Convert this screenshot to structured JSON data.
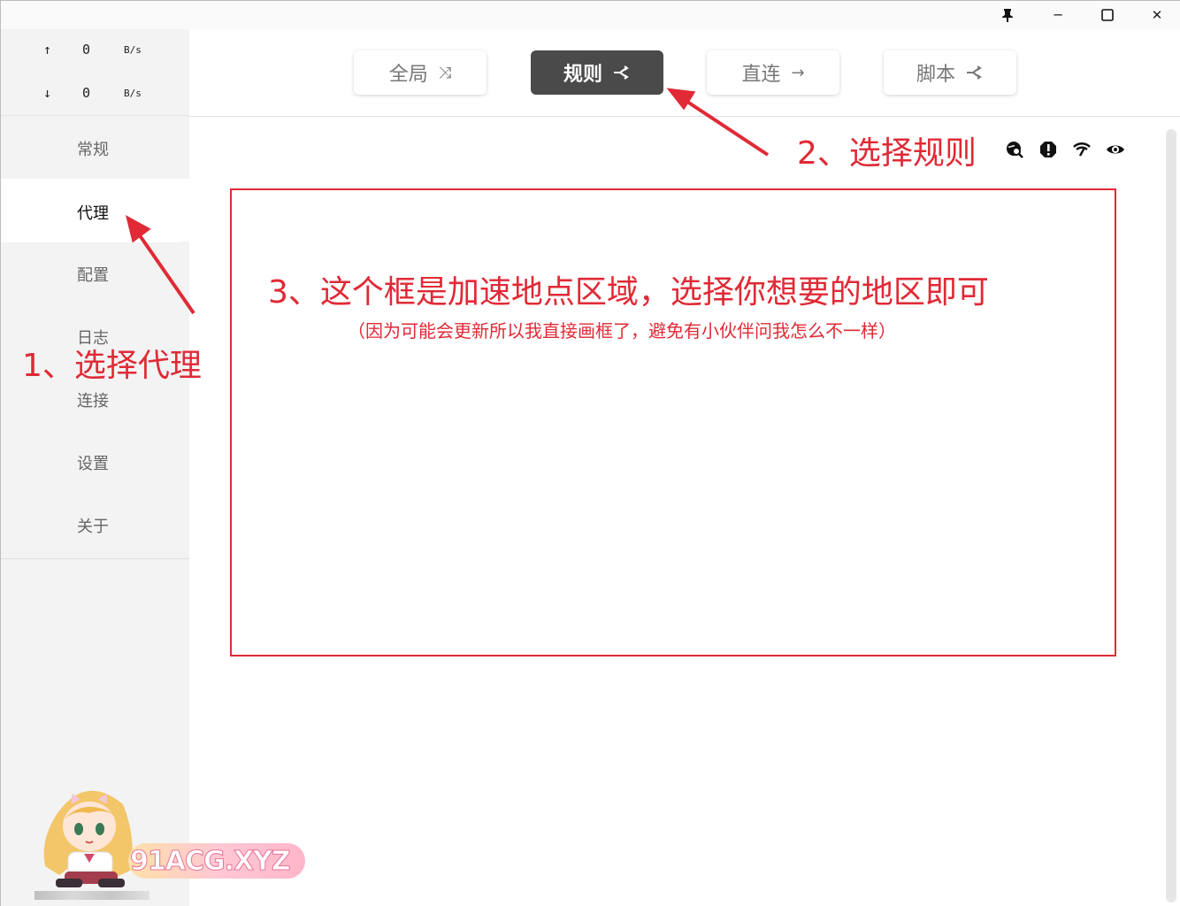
{
  "window": {
    "pin_icon": "pin-icon",
    "min_glyph": "─",
    "close_glyph": "✕"
  },
  "traffic": {
    "up_arrow": "↑",
    "up_value": "0",
    "up_unit": "B/s",
    "down_arrow": "↓",
    "down_value": "0",
    "down_unit": "B/s"
  },
  "sidebar": {
    "items": [
      {
        "label": "常规"
      },
      {
        "label": "代理"
      },
      {
        "label": "配置"
      },
      {
        "label": "日志"
      },
      {
        "label": "连接"
      },
      {
        "label": "设置"
      },
      {
        "label": "关于"
      }
    ],
    "active_index": 1
  },
  "modes": {
    "global": {
      "label": "全局",
      "icon": "⤨"
    },
    "rule": {
      "label": "规则",
      "icon": "⊰"
    },
    "direct": {
      "label": "直连",
      "icon": "→"
    },
    "script": {
      "label": "脚本",
      "icon": "⊰"
    },
    "active": "rule"
  },
  "toolbar": {
    "icons": [
      "globe-search-icon",
      "alert-icon",
      "wifi-speed-icon",
      "eye-icon"
    ]
  },
  "annotations": {
    "step1": "1、选择代理",
    "step2": "2、选择规则",
    "step3": "3、这个框是加速地点区域，选择你想要的地区即可",
    "step3_note": "（因为可能会更新所以我直接画框了，避免有小伙伴问我怎么不一样）"
  },
  "watermark": {
    "text": "91ACG.XYZ"
  },
  "colors": {
    "annotation_red": "#e02a36",
    "active_mode_bg": "#4a4a4a",
    "sidebar_bg": "#f3f3f3"
  }
}
